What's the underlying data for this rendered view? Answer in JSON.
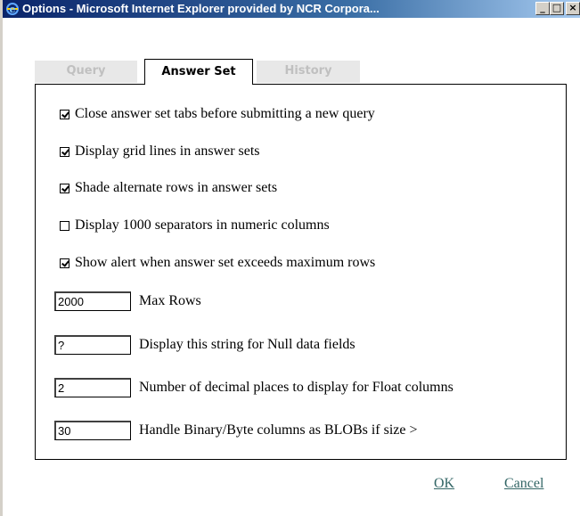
{
  "window": {
    "title": "Options - Microsoft Internet Explorer provided by NCR Corpora...",
    "minimize_glyph": "_",
    "maximize_glyph": "□",
    "close_glyph": "×"
  },
  "tabs": [
    {
      "label": "Query",
      "active": false
    },
    {
      "label": "Answer Set",
      "active": true
    },
    {
      "label": "History",
      "active": false
    }
  ],
  "options": [
    {
      "label": "Close answer set tabs before submitting a new query",
      "checked": true
    },
    {
      "label": "Display grid lines in answer sets",
      "checked": true
    },
    {
      "label": "Shade alternate rows in answer sets",
      "checked": true
    },
    {
      "label": "Display 1000 separators in numeric columns",
      "checked": false
    },
    {
      "label": "Show alert when answer set exceeds maximum rows",
      "checked": true
    }
  ],
  "fields": [
    {
      "value": "2000",
      "label": "Max Rows"
    },
    {
      "value": "?",
      "label": "Display this string for Null data fields"
    },
    {
      "value": "2",
      "label": "Number of decimal places to display for Float columns"
    },
    {
      "value": "30",
      "label": "Handle Binary/Byte columns as BLOBs if size >"
    }
  ],
  "actions": {
    "ok_label": "OK",
    "cancel_label": "Cancel"
  },
  "colors": {
    "link": "#336666",
    "titlebar_start": "#0a246a",
    "titlebar_end": "#a6caf0"
  }
}
